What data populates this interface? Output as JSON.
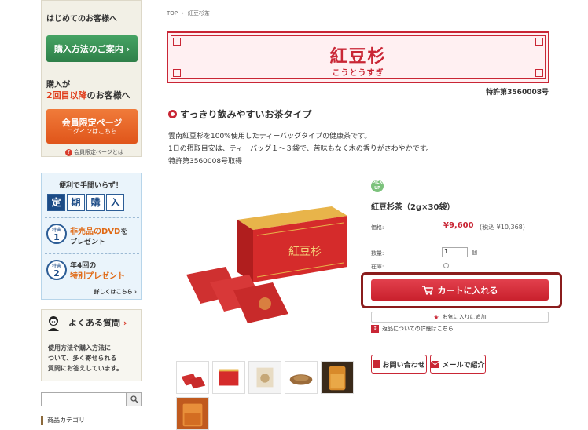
{
  "sidebar": {
    "first_visit": "はじめてのお客様へ",
    "purchase_guide": "購入方法のご案内",
    "repeat_line1": "購入が",
    "repeat_highlight": "2回目以降",
    "repeat_suffix": "のお客様へ",
    "member_line1": "会員限定ページ",
    "member_line2": "ログインはこちら",
    "member_note": "会員限定ページとは",
    "teiki_title": "便利で手間いらず！",
    "teiki_chars": [
      "定",
      "期",
      "購",
      "入"
    ],
    "benefit1_badge": "特典",
    "benefit1_num": "1",
    "benefit1_line1": "非売品のDVD",
    "benefit1_line1_suffix": "を",
    "benefit1_line2": "プレゼント",
    "benefit2_badge": "特典",
    "benefit2_num": "2",
    "benefit2_line1": "年4回の",
    "benefit2_line2": "特別プレゼント",
    "teiki_more": "詳しくはこちら",
    "faq_title": "よくある質問",
    "faq_desc_1": "使用方法や購入方法に",
    "faq_desc_2": "ついて、多く寄せられる",
    "faq_desc_3": "質問にお答えしています。",
    "category_label": "商品カテゴリ"
  },
  "breadcrumb": {
    "top": "TOP",
    "current": "紅豆杉茶"
  },
  "banner": {
    "title": "紅豆杉",
    "reading": "こうとうすぎ",
    "patent": "特許第3560008号"
  },
  "section": {
    "heading": "すっきり飲みやすいお茶タイプ",
    "desc1": "雲南紅豆杉を100%使用したティーバッグタイプの健康茶です。",
    "desc2": "1日の摂取目安は、ティーバッグ１～３袋で、苦味もなく木の香りがさわやかです。",
    "desc3": "特許第3560008号取得"
  },
  "product": {
    "pick_badge": "PICK UP",
    "name": "紅豆杉茶（2g×30袋）",
    "price_label": "価格:",
    "price": "¥9,600",
    "tax_price": "(税込 ¥10,368)",
    "qty_label": "数量:",
    "qty_value": "1",
    "qty_unit": "個",
    "stock_label": "在庫:",
    "cart_button": "カートに入れる",
    "fav_button": "お気に入りに追加",
    "return_link": "返品についての詳細はこちら",
    "inquiry_button": "お問い合わせ",
    "mail_button": "メールで紹介"
  },
  "colors": {
    "accent": "#c92635",
    "green": "#3a9558",
    "orange": "#e8641f"
  }
}
